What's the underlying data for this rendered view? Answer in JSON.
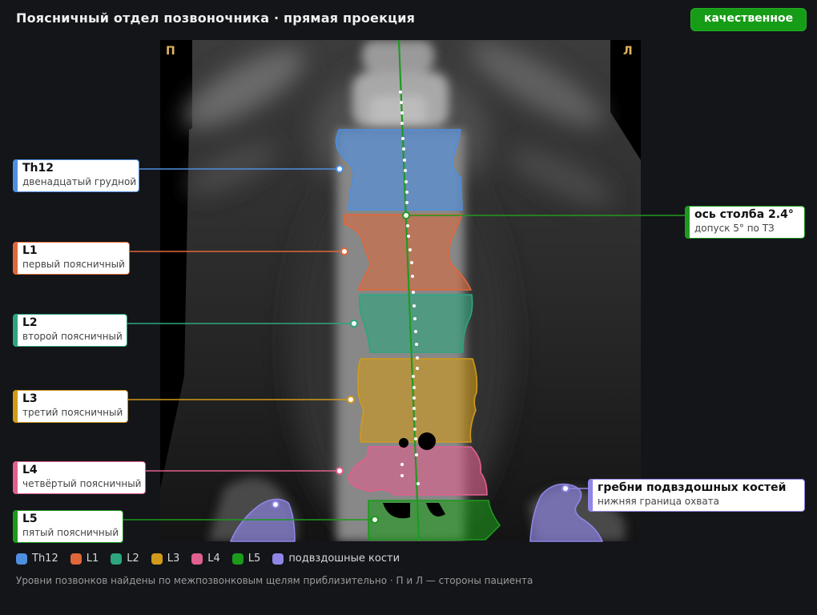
{
  "header": {
    "title": "Поясничный отдел позвоночника · прямая проекция",
    "badge": "качественное"
  },
  "image": {
    "side_right": "П",
    "side_left": "Л"
  },
  "colors": {
    "th12": "#4f8fe0",
    "l1": "#e0673a",
    "l2": "#2ea57e",
    "l3": "#d19a1a",
    "l4": "#e0608f",
    "l5": "#1c9a1c",
    "iliac": "#8f86e6",
    "axis": "#1f9a1f"
  },
  "callouts": [
    {
      "id": "th12",
      "name": "Th12",
      "desc": "двенадцатый грудной"
    },
    {
      "id": "l1",
      "name": "L1",
      "desc": "первый поясничный"
    },
    {
      "id": "l2",
      "name": "L2",
      "desc": "второй поясничный"
    },
    {
      "id": "l3",
      "name": "L3",
      "desc": "третий поясничный"
    },
    {
      "id": "l4",
      "name": "L4",
      "desc": "четвёртый поясничный"
    },
    {
      "id": "l5",
      "name": "L5",
      "desc": "пятый поясничный"
    }
  ],
  "axis_callout": {
    "name": "ось столба 2.4°",
    "desc": "допуск 5° по ТЗ"
  },
  "iliac_callout": {
    "name": "гребни подвздошных костей",
    "desc": "нижняя граница охвата"
  },
  "legend": [
    {
      "label": "Th12",
      "color": "#4f8fe0"
    },
    {
      "label": "L1",
      "color": "#e0673a"
    },
    {
      "label": "L2",
      "color": "#2ea57e"
    },
    {
      "label": "L3",
      "color": "#d19a1a"
    },
    {
      "label": "L4",
      "color": "#e0608f"
    },
    {
      "label": "L5",
      "color": "#1c9a1c"
    },
    {
      "label": "подвздошные кости",
      "color": "#8f86e6"
    }
  ],
  "footnote": "Уровни позвонков найдены по межпозвонковым щелям приблизительно · П и Л — стороны пациента"
}
